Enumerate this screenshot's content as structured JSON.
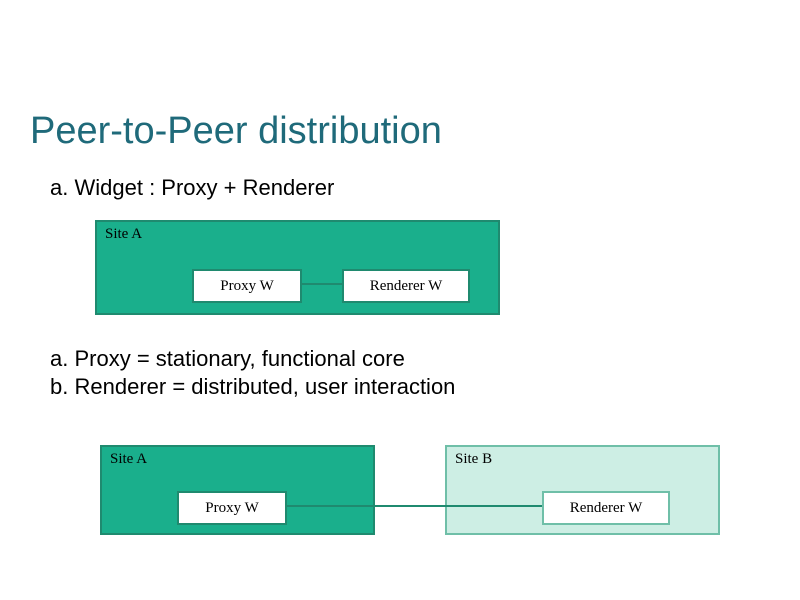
{
  "title": "Peer-to-Peer distribution",
  "sub_a_prefix": "a.",
  "sub_a_text": "Widget : Proxy + Renderer",
  "def_a_prefix": "a.",
  "def_a_text": "Proxy = stationary, functional core",
  "def_b_prefix": "b.",
  "def_b_text": "Renderer = distributed, user interaction",
  "siteA_label": "Site A",
  "siteB_label": "Site B",
  "proxy_label": "Proxy W",
  "renderer_label": "Renderer W",
  "colors": {
    "title": "#1f6a7a",
    "site_green": "#1aaf8c",
    "site_border": "#1f8a6f",
    "site_light": "#cdeee4",
    "light_border": "#6fbfa8",
    "line": "#1f8a6f"
  }
}
